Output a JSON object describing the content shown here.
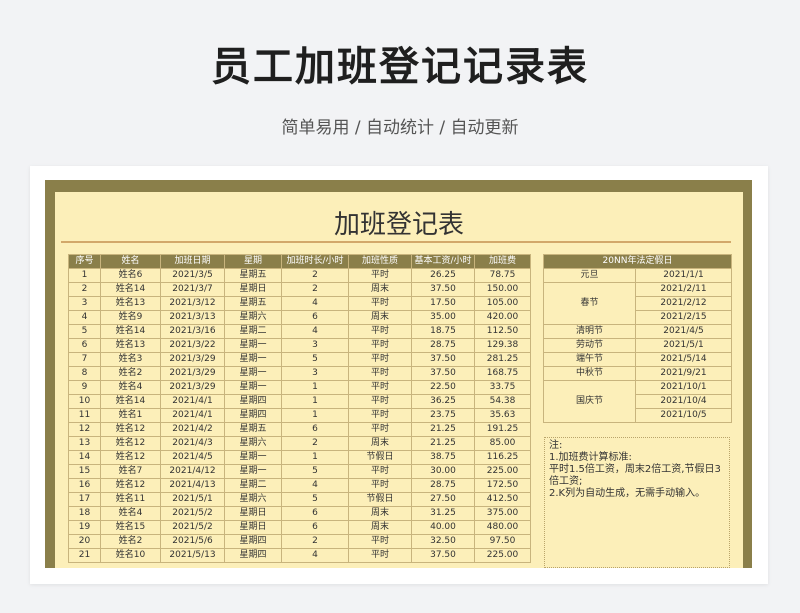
{
  "header": {
    "title": "员工加班登记记录表",
    "subtitle": "简单易用 / 自动统计 / 自动更新"
  },
  "sheet": {
    "title": "加班登记表",
    "columns": [
      "序号",
      "姓名",
      "加班日期",
      "星期",
      "加班时长/小时",
      "加班性质",
      "基本工资/小时",
      "加班费"
    ],
    "rows": [
      [
        "1",
        "姓名6",
        "2021/3/5",
        "星期五",
        "2",
        "平时",
        "26.25",
        "78.75"
      ],
      [
        "2",
        "姓名14",
        "2021/3/7",
        "星期日",
        "2",
        "周末",
        "37.50",
        "150.00"
      ],
      [
        "3",
        "姓名13",
        "2021/3/12",
        "星期五",
        "4",
        "平时",
        "17.50",
        "105.00"
      ],
      [
        "4",
        "姓名9",
        "2021/3/13",
        "星期六",
        "6",
        "周末",
        "35.00",
        "420.00"
      ],
      [
        "5",
        "姓名14",
        "2021/3/16",
        "星期二",
        "4",
        "平时",
        "18.75",
        "112.50"
      ],
      [
        "6",
        "姓名13",
        "2021/3/22",
        "星期一",
        "3",
        "平时",
        "28.75",
        "129.38"
      ],
      [
        "7",
        "姓名3",
        "2021/3/29",
        "星期一",
        "5",
        "平时",
        "37.50",
        "281.25"
      ],
      [
        "8",
        "姓名2",
        "2021/3/29",
        "星期一",
        "3",
        "平时",
        "37.50",
        "168.75"
      ],
      [
        "9",
        "姓名4",
        "2021/3/29",
        "星期一",
        "1",
        "平时",
        "22.50",
        "33.75"
      ],
      [
        "10",
        "姓名14",
        "2021/4/1",
        "星期四",
        "1",
        "平时",
        "36.25",
        "54.38"
      ],
      [
        "11",
        "姓名1",
        "2021/4/1",
        "星期四",
        "1",
        "平时",
        "23.75",
        "35.63"
      ],
      [
        "12",
        "姓名12",
        "2021/4/2",
        "星期五",
        "6",
        "平时",
        "21.25",
        "191.25"
      ],
      [
        "13",
        "姓名12",
        "2021/4/3",
        "星期六",
        "2",
        "周末",
        "21.25",
        "85.00"
      ],
      [
        "14",
        "姓名12",
        "2021/4/5",
        "星期一",
        "1",
        "节假日",
        "38.75",
        "116.25"
      ],
      [
        "15",
        "姓名7",
        "2021/4/12",
        "星期一",
        "5",
        "平时",
        "30.00",
        "225.00"
      ],
      [
        "16",
        "姓名12",
        "2021/4/13",
        "星期二",
        "4",
        "平时",
        "28.75",
        "172.50"
      ],
      [
        "17",
        "姓名11",
        "2021/5/1",
        "星期六",
        "5",
        "节假日",
        "27.50",
        "412.50"
      ],
      [
        "18",
        "姓名4",
        "2021/5/2",
        "星期日",
        "6",
        "周末",
        "31.25",
        "375.00"
      ],
      [
        "19",
        "姓名15",
        "2021/5/2",
        "星期日",
        "6",
        "周末",
        "40.00",
        "480.00"
      ],
      [
        "20",
        "姓名2",
        "2021/5/6",
        "星期四",
        "2",
        "平时",
        "32.50",
        "97.50"
      ],
      [
        "21",
        "姓名10",
        "2021/5/13",
        "星期四",
        "4",
        "平时",
        "37.50",
        "225.00"
      ]
    ]
  },
  "holidays": {
    "title": "20NN年法定假日",
    "groups": [
      {
        "name": "元旦",
        "dates": [
          "2021/1/1"
        ]
      },
      {
        "name": "春节",
        "dates": [
          "2021/2/11",
          "2021/2/12",
          "2021/2/15"
        ]
      },
      {
        "name": "清明节",
        "dates": [
          "2021/4/5"
        ]
      },
      {
        "name": "劳动节",
        "dates": [
          "2021/5/1"
        ]
      },
      {
        "name": "端午节",
        "dates": [
          "2021/5/14"
        ]
      },
      {
        "name": "中秋节",
        "dates": [
          "2021/9/21"
        ]
      },
      {
        "name": "国庆节",
        "dates": [
          "2021/10/1",
          "2021/10/4",
          "2021/10/5"
        ]
      }
    ]
  },
  "notes": {
    "heading": "注:",
    "lines": [
      "1.加班费计算标准:",
      "平时1.5倍工资，周末2倍工资,节假日3倍工资;",
      "2.K列为自动生成，无需手动输入。"
    ]
  },
  "colors": {
    "frame": "#8a7f4a",
    "paper": "#fcefb9",
    "grid_line": "#c8b47d",
    "title_rule": "#d2a86a"
  }
}
